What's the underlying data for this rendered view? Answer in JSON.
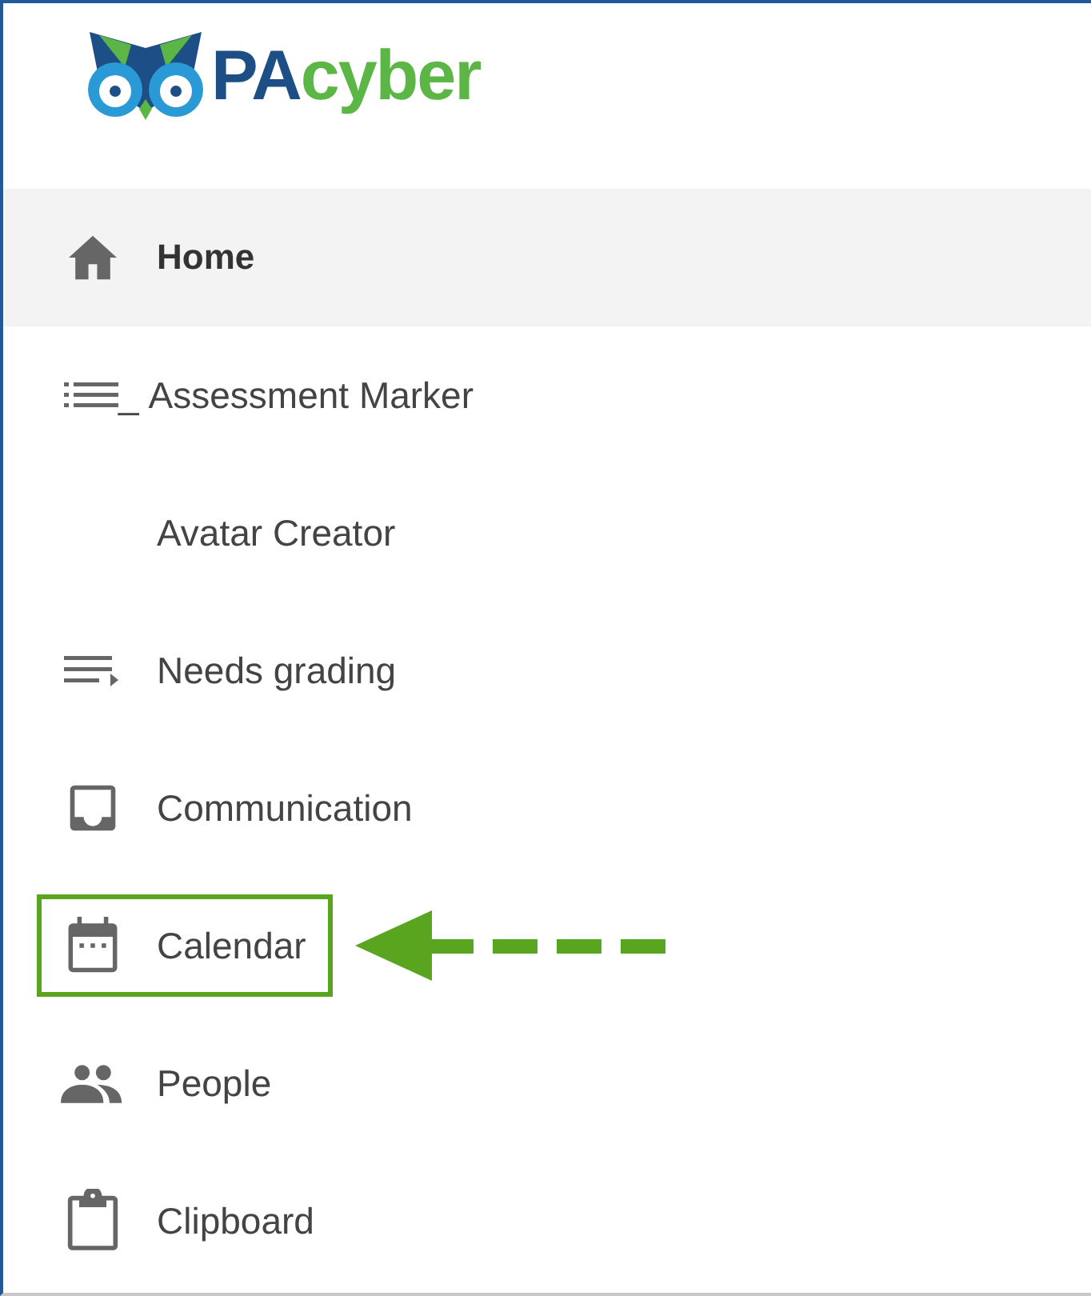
{
  "logo": {
    "parts": [
      {
        "text": "PA",
        "color": "#1d4f86"
      },
      {
        "text": "cyber",
        "color": "#5cb646"
      }
    ]
  },
  "nav": [
    {
      "label": "Home",
      "selected": true,
      "highlighted": false
    },
    {
      "prefix": "_",
      "label": "Assessment Marker",
      "selected": false,
      "highlighted": false
    },
    {
      "label": "Avatar Creator",
      "selected": false,
      "highlighted": false
    },
    {
      "label": "Needs grading",
      "selected": false,
      "highlighted": false
    },
    {
      "label": "Communication",
      "selected": false,
      "highlighted": false
    },
    {
      "label": "Calendar",
      "selected": false,
      "highlighted": true
    },
    {
      "label": "People",
      "selected": false,
      "highlighted": false
    },
    {
      "label": "Clipboard",
      "selected": false,
      "highlighted": false
    }
  ]
}
